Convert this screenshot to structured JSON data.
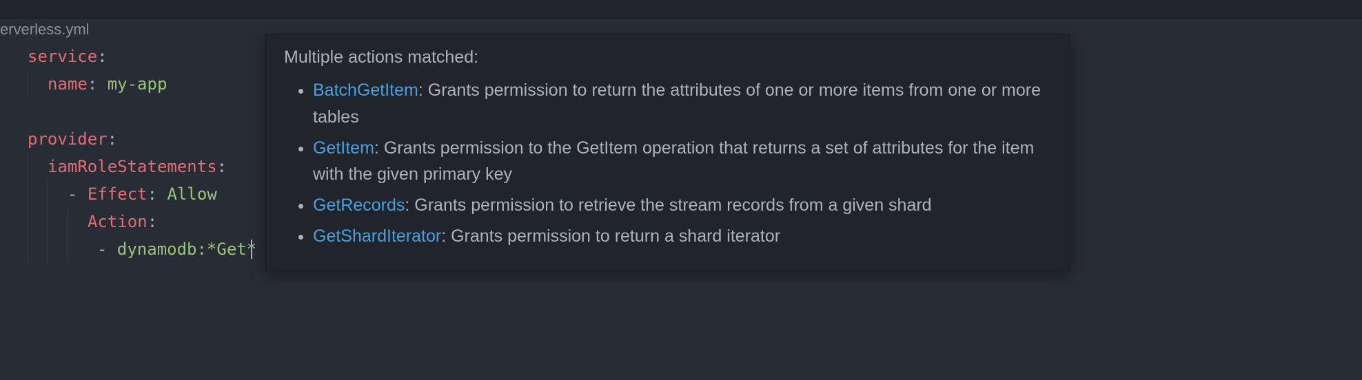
{
  "file": {
    "name": "erverless.yml"
  },
  "code": {
    "service": {
      "key": "service",
      "name_key": "name",
      "name_value": "my-app"
    },
    "provider": {
      "key": "provider",
      "iam_key": "iamRoleStatements",
      "effect_key": "Effect",
      "effect_value": "Allow",
      "action_key": "Action",
      "action_item": "dynamodb:*Get*"
    }
  },
  "hover": {
    "title": "Multiple actions matched:",
    "items": [
      {
        "name": "BatchGetItem",
        "desc": ": Grants permission to return the attributes of one or more items from one or more tables"
      },
      {
        "name": "GetItem",
        "desc": ": Grants permission to the GetItem operation that returns a set of attributes for the item with the given primary key"
      },
      {
        "name": "GetRecords",
        "desc": ": Grants permission to retrieve the stream records from a given shard"
      },
      {
        "name": "GetShardIterator",
        "desc": ": Grants permission to return a shard iterator"
      }
    ]
  }
}
